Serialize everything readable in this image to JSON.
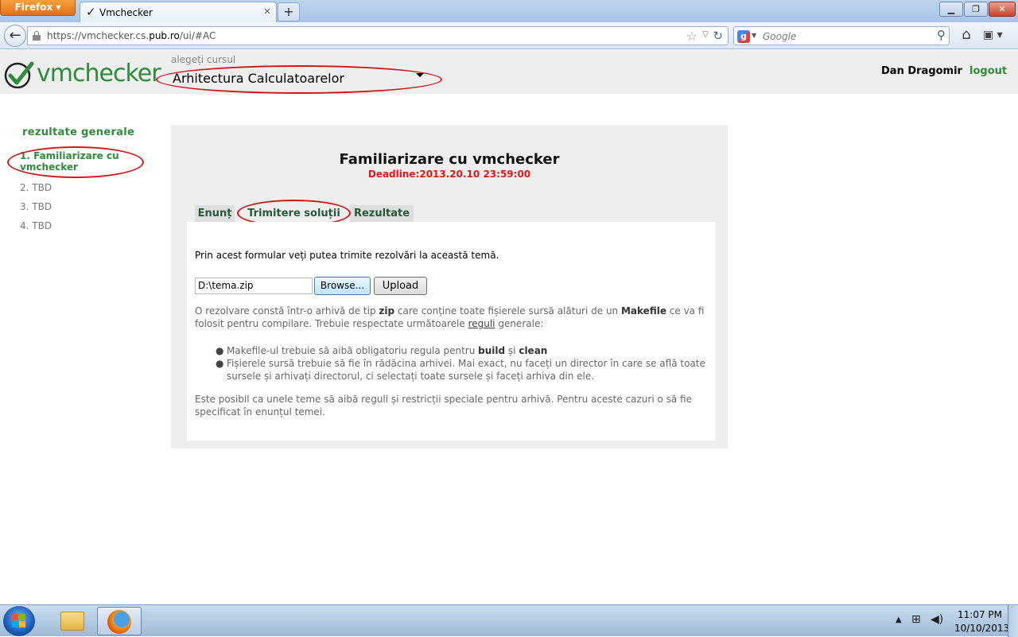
{
  "browser": {
    "app_button": "Firefox",
    "tab_title": "Vmchecker",
    "url_prefix": "https://vmchecker.cs.",
    "url_domain": "pub.ro",
    "url_suffix": "/ui/#AC",
    "search_placeholder": "Google"
  },
  "header": {
    "logo_prefix": "vm",
    "logo_suffix": "checker",
    "course_label": "alegeți cursul",
    "course_value": "Arhitectura Calculatoarelor",
    "user_name": "Dan Dragomir",
    "logout_label": "logout"
  },
  "sidebar": {
    "title": "rezultate generale",
    "items": [
      {
        "label": "1. Familiarizare cu vmchecker"
      },
      {
        "label": "2. TBD"
      },
      {
        "label": "3. TBD"
      },
      {
        "label": "4. TBD"
      }
    ]
  },
  "main": {
    "title": "Familiarizare cu vmchecker",
    "deadline": "Deadline:2013.20.10 23:59:00",
    "tabs": [
      {
        "label": "Enunț"
      },
      {
        "label": "Trimitere soluții"
      },
      {
        "label": "Rezultate"
      }
    ],
    "intro": "Prin acest formular veți putea trimite rezolvări la această temă.",
    "file_value": "D:\\tema.zip",
    "browse_label": "Browse...",
    "upload_label": "Upload",
    "para1": {
      "t1": "O rezolvare constă într-o arhivă de tip ",
      "b1": "zip",
      "t2": " care conține toate fișierele sursă alături de un ",
      "b2": "Makefile",
      "t3": " ce va fi folosit pentru compilare. Trebuie respectate următoarele ",
      "u1": "reguli",
      "t4": " generale:"
    },
    "rule1": {
      "t1": "Makefile-ul trebuie să aibă obligatoriu regula pentru ",
      "b1": "build",
      "t2": " și ",
      "b2": "clean"
    },
    "rule2": "Fișierele sursă trebuie să fie în rădăcina arhivei. Mai exact, nu faceți un director în care se află toate sursele și arhivați directorul, ci selectați toate sursele și faceți arhiva din ele.",
    "para2": "Este posibil ca unele teme să aibă reguli și restricții speciale pentru arhivă. Pentru aceste cazuri o să fie specificat în enunțul temei."
  },
  "taskbar": {
    "time": "11:07 PM",
    "date": "10/10/2013"
  },
  "colors": {
    "brand_green": "#2e8b3a",
    "deadline_red": "#e01818",
    "annotation_red": "#d01818"
  }
}
